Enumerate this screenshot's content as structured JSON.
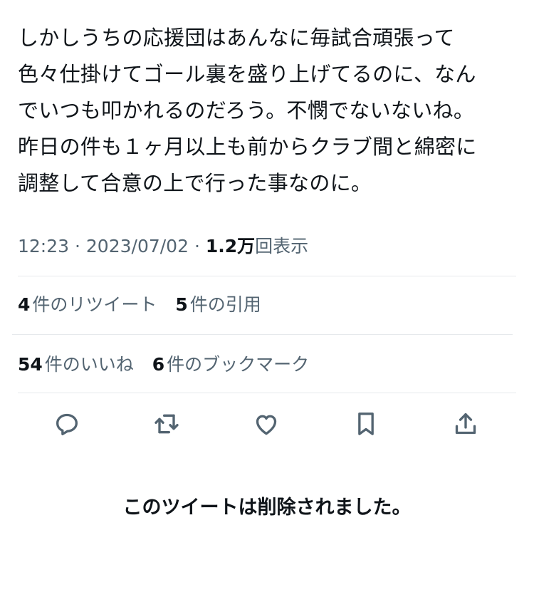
{
  "tweet": {
    "lines": [
      "しかしうちの応援団はあんなに毎試合頑張って",
      "色々仕掛けてゴール裏を盛り上げてるのに、なん",
      "でいつも叩かれるのだろう。不憫でないないね。",
      "昨日の件も１ヶ月以上も前からクラブ間と綿密に",
      "調整して合意の上で行った事なのに。"
    ]
  },
  "meta": {
    "time": "12:23",
    "separator": "·",
    "date": "2023/07/02",
    "views_count": "1.2万",
    "views_label": "回表示"
  },
  "stats": {
    "retweets": {
      "count": "4",
      "label": "件のリツイート"
    },
    "quotes": {
      "count": "5",
      "label": "件の引用"
    },
    "likes": {
      "count": "54",
      "label": "件のいいね"
    },
    "bookmarks": {
      "count": "6",
      "label": "件のブックマーク"
    }
  },
  "actions": [
    "reply-icon",
    "retweet-icon",
    "like-icon",
    "bookmark-icon",
    "share-icon"
  ],
  "notice": {
    "deleted": "このツイートは削除されました。"
  },
  "colors": {
    "text": "#0f1419",
    "secondary": "#536471",
    "divider": "#e6e9ec"
  }
}
